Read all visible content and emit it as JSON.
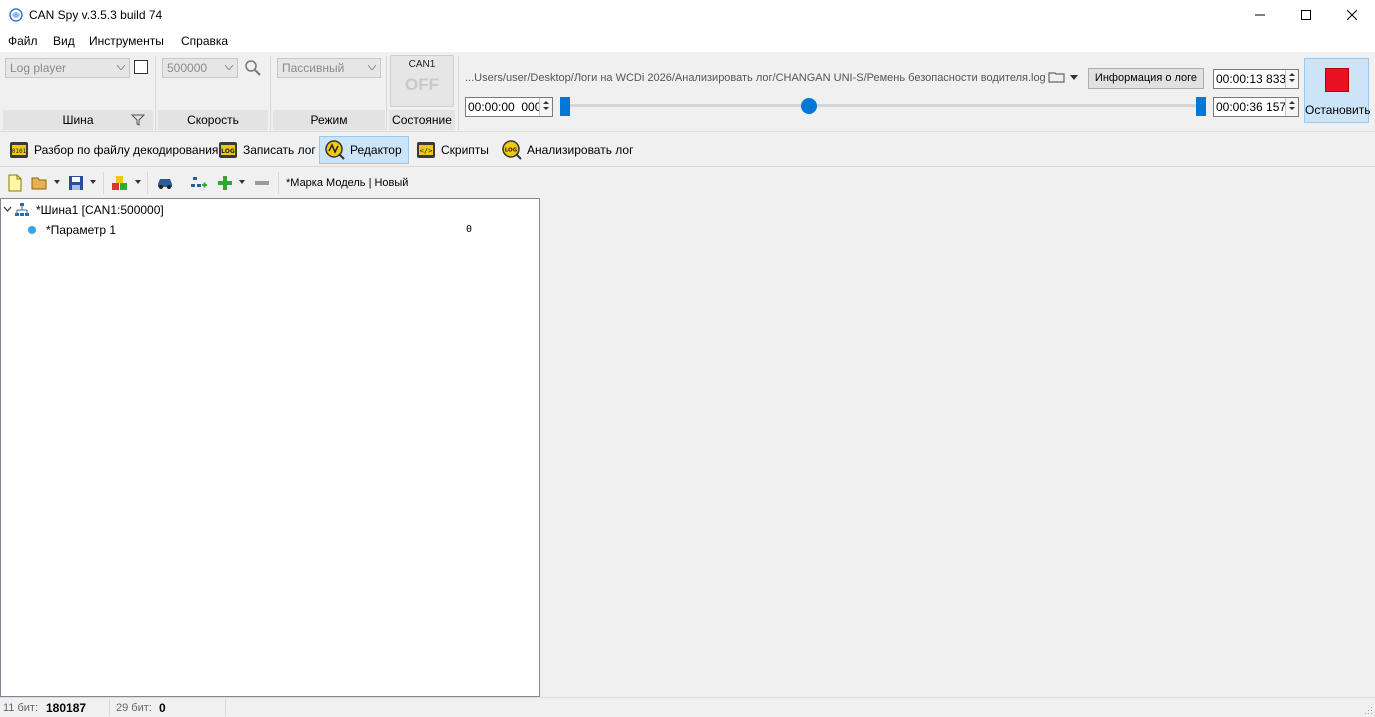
{
  "window": {
    "title": "CAN Spy v.3.5.3 build 74",
    "minimize": "—",
    "maximize": "☐",
    "close": "✕"
  },
  "menu": [
    "Файл",
    "Вид",
    "Инструменты",
    "Справка"
  ],
  "ribbon": {
    "bus": {
      "combo": "Log player",
      "label": "Шина"
    },
    "speed": {
      "combo": "500000",
      "label": "Скорость"
    },
    "mode": {
      "combo": "Пассивный",
      "label": "Режим"
    },
    "state": {
      "channel": "CAN1",
      "status": "OFF",
      "label": "Состояние"
    },
    "log": {
      "path": "...Users/user/Desktop/Логи на WCDi 2026/Анализировать лог/CHANGAN UNI-S/Ремень безопасности водителя.log",
      "info_button": "Информация о логе",
      "start_time": "00:00:00  000",
      "current_time": "00:00:13 833",
      "end_time": "00:00:36 157",
      "position_fraction": 0.383
    },
    "stop_button": "Остановить"
  },
  "tabs": [
    {
      "label": "Разбор по файлу декодирования",
      "icon": "decode-file-icon",
      "active": false
    },
    {
      "label": "Записать лог",
      "icon": "log-record-icon",
      "active": false
    },
    {
      "label": "Редактор",
      "icon": "editor-icon",
      "active": true
    },
    {
      "label": "Скрипты",
      "icon": "scripts-icon",
      "active": false
    },
    {
      "label": "Анализировать лог",
      "icon": "analyze-log-icon",
      "active": false
    }
  ],
  "editor": {
    "model_label": "*Марка Модель | Новый",
    "tree": {
      "bus_label": "*Шина1 [CAN1:500000]",
      "param_label": "*Параметр 1",
      "param_value": "0"
    }
  },
  "status": {
    "bit11_label": "11 бит:",
    "bit11_value": "180187",
    "bit29_label": "29 бит:",
    "bit29_value": "0"
  },
  "colors": {
    "accent": "#0078d7",
    "stop_red": "#e81123",
    "active_tab": "#cce4f7"
  }
}
